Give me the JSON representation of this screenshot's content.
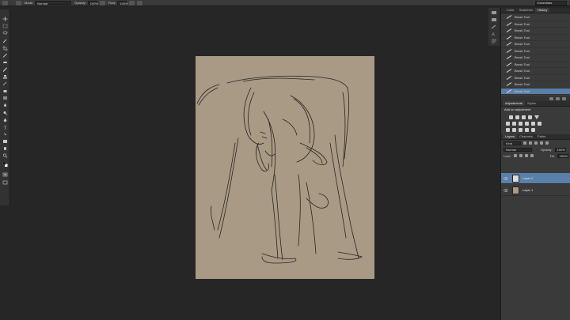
{
  "options_bar": {
    "mode_label": "Mode:",
    "mode_value": "Normal",
    "opacity_label": "Opacity:",
    "opacity_value": "100%",
    "flow_label": "Flow:",
    "flow_value": "100%",
    "workspace_value": "Essentials"
  },
  "history_panel": {
    "tabs": [
      "Color",
      "Swatches",
      "History"
    ],
    "active_tab": "History",
    "items": [
      {
        "label": "Brush Tool",
        "icon": "brush-icon"
      },
      {
        "label": "Brush Tool",
        "icon": "brush-icon"
      },
      {
        "label": "Brush Tool",
        "icon": "brush-icon"
      },
      {
        "label": "Brush Tool",
        "icon": "brush-icon"
      },
      {
        "label": "Brush Tool",
        "icon": "brush-icon"
      },
      {
        "label": "Brush Tool",
        "icon": "brush-icon"
      },
      {
        "label": "Brush Tool",
        "icon": "brush-icon"
      },
      {
        "label": "Brush Tool",
        "icon": "brush-icon"
      },
      {
        "label": "Brush Tool",
        "icon": "brush-icon"
      },
      {
        "label": "Brush Tool",
        "icon": "brush-icon"
      },
      {
        "label": "Brush Tool",
        "icon": "brush-icon"
      },
      {
        "label": "Brush Tool",
        "icon": "brush-icon"
      }
    ],
    "active_index": 11
  },
  "adjustments_panel": {
    "tabs": [
      "Adjustments",
      "Styles"
    ],
    "active_tab": "Adjustments",
    "title": "Add an adjustment"
  },
  "layers_panel": {
    "tabs": [
      "Layers",
      "Channels",
      "Paths"
    ],
    "active_tab": "Layers",
    "kind_value": "Kind",
    "blend_value": "Normal",
    "opacity_label": "Opacity:",
    "opacity_value": "100%",
    "lock_label": "Lock:",
    "fill_label": "Fill:",
    "fill_value": "100%",
    "layers": [
      {
        "name": "Layer 2",
        "selected": true,
        "thumb_color": "#dcdcdc"
      },
      {
        "name": "Layer 1",
        "selected": false,
        "thumb_color": "#a89a85"
      }
    ]
  },
  "colors": {
    "canvas": "#a89a85",
    "selection": "#5a7fa8",
    "sketch_stroke": "#2b241e"
  },
  "toolbox_icons": [
    "move-icon",
    "marquee-icon",
    "lasso-icon",
    "quick-select-icon",
    "crop-icon",
    "eyedropper-icon",
    "healing-icon",
    "brush-icon",
    "stamp-icon",
    "history-brush-icon",
    "eraser-icon",
    "gradient-icon",
    "blur-icon",
    "dodge-icon",
    "pen-icon",
    "type-icon",
    "path-select-icon",
    "shape-icon",
    "hand-icon",
    "zoom-icon",
    "foreground-background-colors",
    "quick-mask-icon",
    "screen-mode-icon"
  ]
}
